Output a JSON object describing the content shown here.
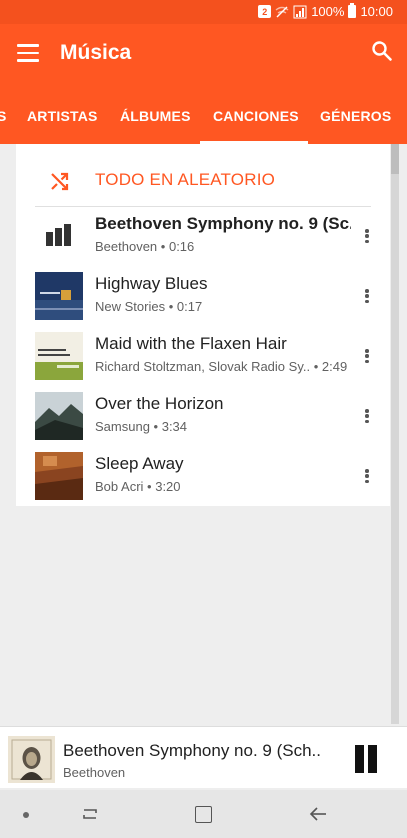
{
  "status_bar": {
    "notification_badge": "2",
    "battery": "100%",
    "time": "10:00"
  },
  "app_bar": {
    "title": "Música",
    "menu_icon": "hamburger-menu-icon",
    "search_icon": "search-icon"
  },
  "tabs": [
    {
      "label": "S",
      "partial": true
    },
    {
      "label": "ARTISTAS"
    },
    {
      "label": "ÁLBUMES"
    },
    {
      "label": "CANCIONES",
      "selected": true
    },
    {
      "label": "GÉNEROS"
    }
  ],
  "shuffle": {
    "label": "TODO EN ALEATORIO",
    "icon": "shuffle-icon"
  },
  "songs": [
    {
      "title": "Beethoven Symphony no. 9 (Sc..",
      "artist": "Beethoven",
      "duration": "0:16",
      "now_playing": true
    },
    {
      "title": "Highway Blues",
      "artist": "New Stories",
      "duration": "0:17"
    },
    {
      "title": "Maid with the Flaxen Hair",
      "artist": "Richard Stoltzman, Slovak Radio Sy..",
      "duration": "2:49"
    },
    {
      "title": "Over the Horizon",
      "artist": "Samsung",
      "duration": "3:34"
    },
    {
      "title": "Sleep Away",
      "artist": "Bob Acri",
      "duration": "3:20"
    }
  ],
  "separator": "•",
  "now_playing": {
    "title": "Beethoven Symphony no. 9 (Sch..",
    "artist": "Beethoven",
    "control_icon": "pause-icon"
  },
  "colors": {
    "accent": "#ff5722",
    "status_bar": "#f4511e"
  }
}
